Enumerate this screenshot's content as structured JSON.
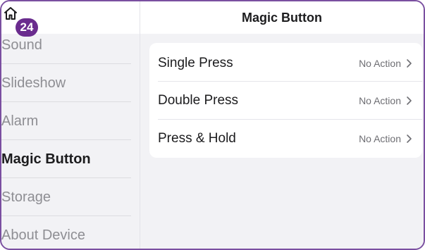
{
  "header": {
    "title": "Magic Button"
  },
  "notification": {
    "badge_count": "24"
  },
  "sidebar": {
    "items": [
      {
        "label": "Sound",
        "active": false
      },
      {
        "label": "Slideshow",
        "active": false
      },
      {
        "label": "Alarm",
        "active": false
      },
      {
        "label": "Magic Button",
        "active": true
      },
      {
        "label": "Storage",
        "active": false
      },
      {
        "label": "About Device",
        "active": false
      }
    ]
  },
  "settings": {
    "rows": [
      {
        "label": "Single Press",
        "value": "No Action"
      },
      {
        "label": "Double Press",
        "value": "No Action"
      },
      {
        "label": "Press & Hold",
        "value": "No Action"
      }
    ]
  },
  "icons": {
    "home": "home-icon",
    "chevron": "chevron-right-icon"
  },
  "colors": {
    "accent": "#6a2c8e",
    "frame_border": "#7a4fa0",
    "background": "#f2f2f5",
    "card": "#ffffff"
  }
}
